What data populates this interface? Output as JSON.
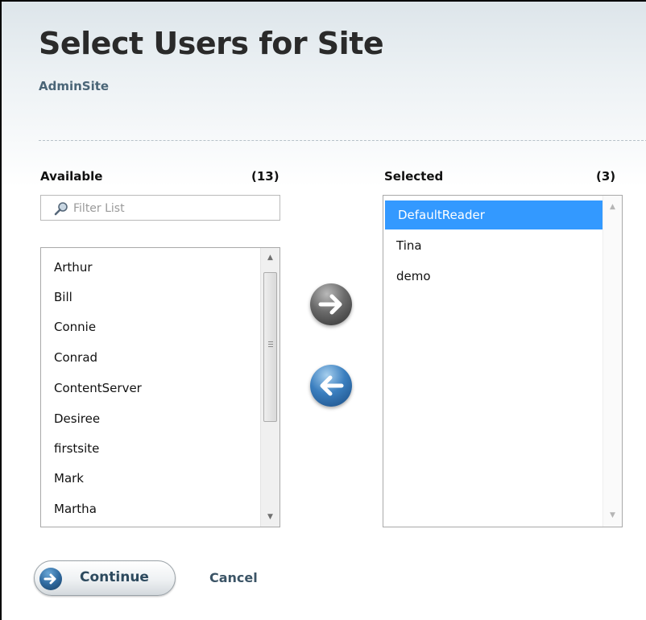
{
  "page": {
    "title": "Select Users for Site",
    "site_name": "AdminSite"
  },
  "available": {
    "label": "Available",
    "count": "(13)",
    "filter_placeholder": "Filter List",
    "items": [
      "Arthur",
      "Bill",
      "Connie",
      "Conrad",
      "ContentServer",
      "Desiree",
      "firstsite",
      "Mark",
      "Martha"
    ]
  },
  "selected": {
    "label": "Selected",
    "count": "(3)",
    "items": [
      "DefaultReader",
      "Tina",
      "demo"
    ],
    "highlighted_index": 0
  },
  "buttons": {
    "move_right_icon": "arrow-right-icon",
    "move_left_icon": "arrow-left-icon",
    "continue_label": "Continue",
    "cancel_label": "Cancel"
  },
  "colors": {
    "selection": "#3399ff",
    "move_left_accent": "#2f6aa0",
    "move_right_accent": "#4a4a4a"
  }
}
